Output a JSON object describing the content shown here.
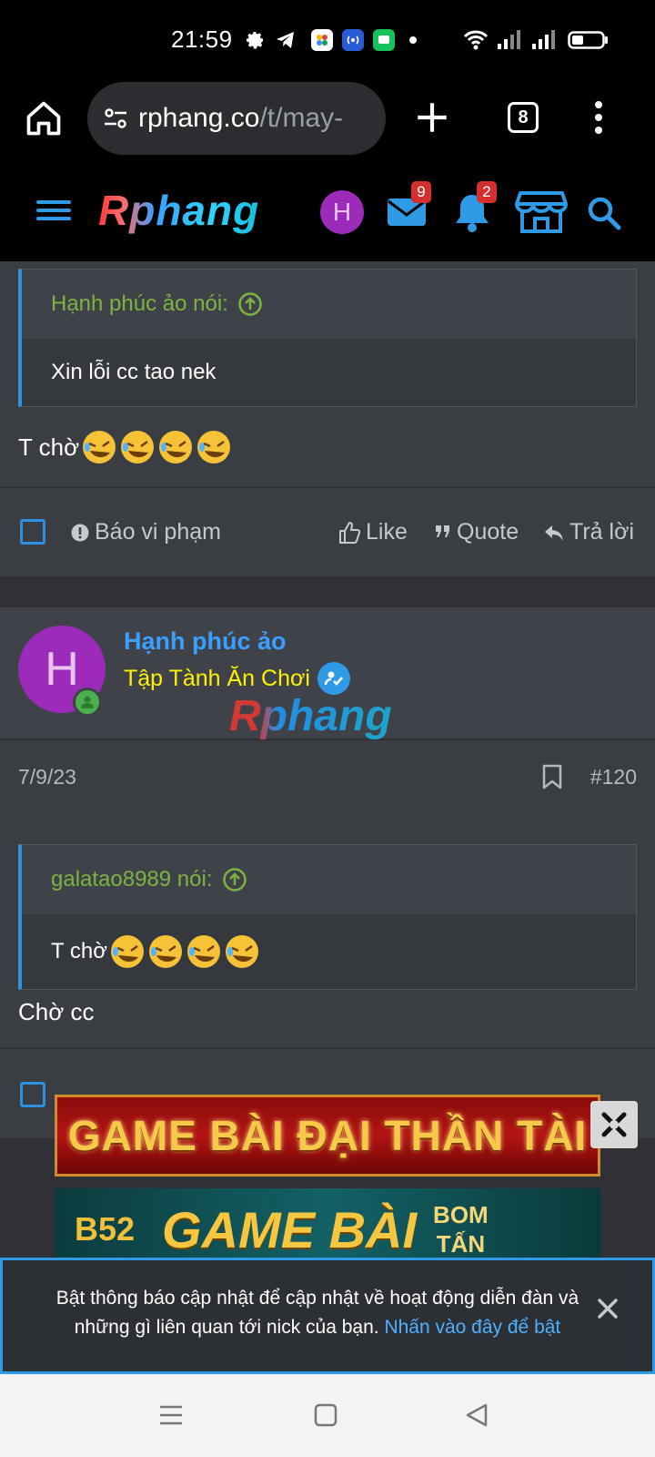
{
  "status_bar": {
    "time": "21:59"
  },
  "browser": {
    "url_domain": "rphang.co",
    "url_path": "/t/may-",
    "tab_count": "8"
  },
  "site_header": {
    "logo": "Rphang",
    "avatar_initial": "H",
    "messages_badge": "9",
    "alerts_badge": "2"
  },
  "post1": {
    "quote_author": "Hạnh phúc ảo nói:",
    "quote_text": "Xin lỗi cc tao nek",
    "body_text": "T chờ",
    "emoji_count": 4
  },
  "actions": {
    "report": "Báo vi phạm",
    "like": "Like",
    "quote": "Quote",
    "reply": "Trả lời"
  },
  "post2": {
    "avatar_initial": "H",
    "username": "Hạnh phúc ảo",
    "user_title": "Tập Tành Ăn Chơi",
    "watermark": "Rphang",
    "date": "7/9/23",
    "post_number": "#120",
    "quote_author": "galatao8989 nói:",
    "quote_text": "T chờ",
    "body_text": "Chờ cc"
  },
  "ads": {
    "ad1_text": "GAME BÀI ĐẠI THẦN TÀI",
    "ad2_brand": "B52",
    "ad2_text": "GAME BÀI",
    "ad2_tag_line1": "BOM",
    "ad2_tag_line2": "TẤN"
  },
  "notice": {
    "text": "Bật thông báo cập nhật để cập nhật về hoạt động diễn đàn và những gì liên quan tới nick của bạn.",
    "link": "Nhấn vào đây để bật"
  },
  "colors": {
    "accent": "#2f8fe0",
    "username": "#3aa0ff",
    "user_title": "#fff200",
    "quote_author": "#7cb342",
    "badge": "#d32f2f"
  },
  "icons": [
    "settings-icon",
    "telegram-icon",
    "photos-icon",
    "hotspot-icon",
    "chat-icon",
    "wifi-icon",
    "signal-icon",
    "battery-icon",
    "home-icon",
    "site-info-icon",
    "new-tab-icon",
    "menu-dots-icon",
    "hamburger-icon",
    "mail-icon",
    "bell-icon",
    "store-icon",
    "search-icon",
    "warning-icon",
    "thumbs-up-icon",
    "quote-icon",
    "reply-icon",
    "bookmark-icon",
    "arrow-up-circle-icon",
    "user-online-icon",
    "verified-icon",
    "close-icon"
  ]
}
